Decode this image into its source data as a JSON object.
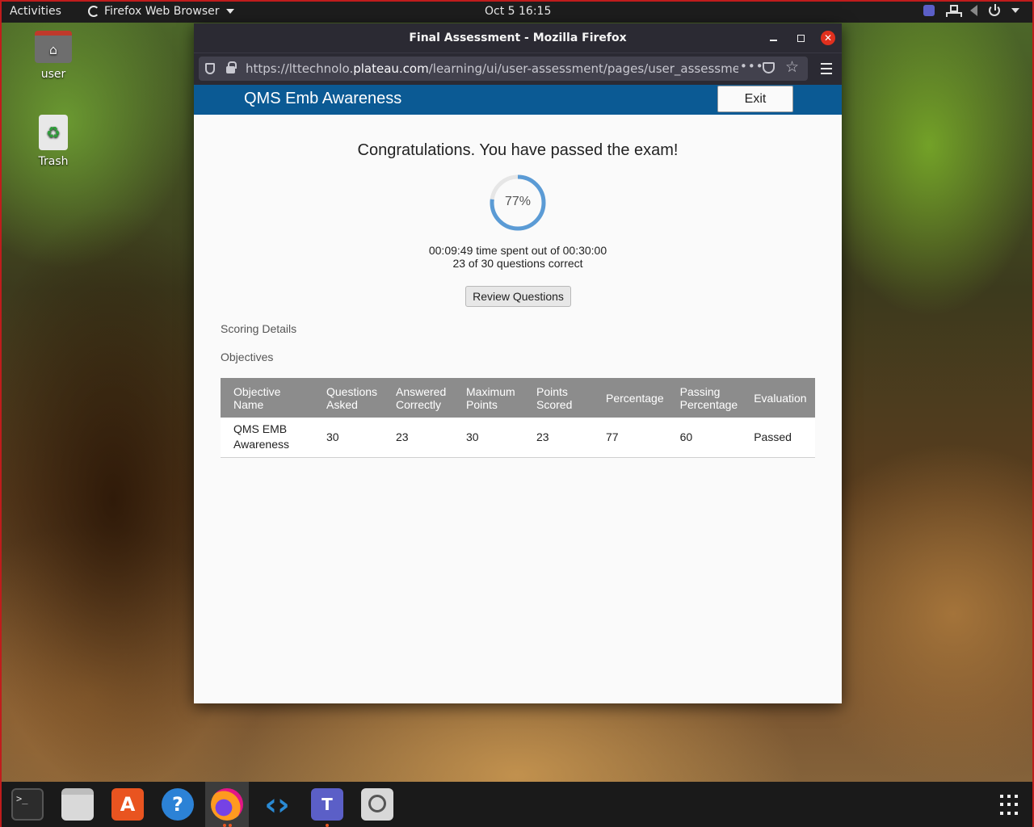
{
  "topbar": {
    "activities": "Activities",
    "app_name": "Firefox Web Browser",
    "clock": "Oct 5  16:15"
  },
  "desktop": {
    "icons": [
      {
        "label": "user",
        "icon": "home-folder-icon"
      },
      {
        "label": "Trash",
        "icon": "trash-icon"
      }
    ]
  },
  "browser": {
    "window_title": "Final Assessment - Mozilla Firefox",
    "url_prefix": "https://lttechnolo.",
    "url_domain": "plateau.com",
    "url_path": "/learning/ui/user-assessment/pages/user_assessment.js",
    "more_glyph": "•••"
  },
  "page": {
    "header_title": "QMS Emb Awareness",
    "exit_label": "Exit",
    "congrats": "Congratulations. You have passed the exam!",
    "score_percent_label": "77%",
    "score_fraction": 0.77,
    "time_text": "00:09:49 time spent out of 00:30:00",
    "correct_text": "23 of 30 questions correct",
    "review_label": "Review Questions",
    "scoring_details": "Scoring Details",
    "objectives": "Objectives",
    "ring_color": "#5b9bd5",
    "header_color": "#0b5a94"
  },
  "table": {
    "headers": [
      "Objective Name",
      "Questions Asked",
      "Answered Correctly",
      "Maximum Points",
      "Points Scored",
      "Percentage",
      "Passing Percentage",
      "Evaluation"
    ],
    "rows": [
      [
        "QMS EMB Awareness",
        "30",
        "23",
        "30",
        "23",
        "77",
        "60",
        "Passed"
      ]
    ]
  },
  "dock": {
    "apps": [
      "terminal-icon",
      "files-icon",
      "software-store-icon",
      "help-icon",
      "firefox-icon",
      "vscode-icon",
      "teams-icon",
      "image-viewer-icon"
    ]
  }
}
